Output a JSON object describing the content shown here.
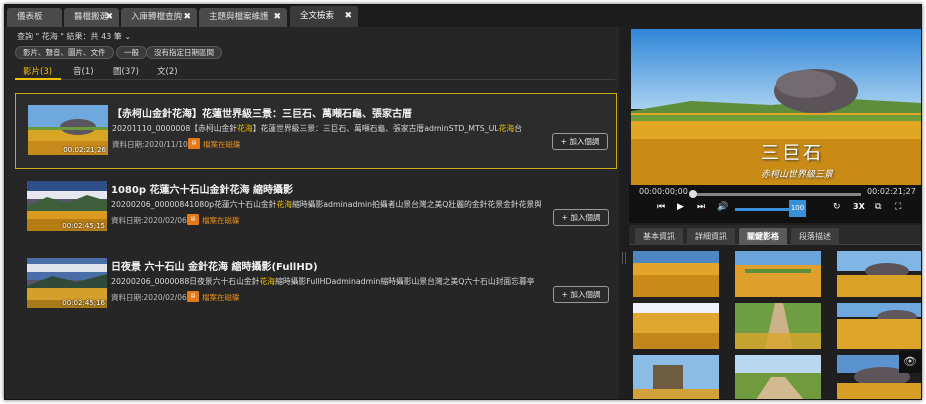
{
  "tabs": [
    {
      "label": "儀表板",
      "closable": false
    },
    {
      "label": "醫檔搬選",
      "closable": true
    },
    {
      "label": "入庫轉檔查詢",
      "closable": true
    },
    {
      "label": "主題與檔案維護",
      "closable": true
    },
    {
      "label": "全文檢索",
      "closable": true,
      "active": true
    }
  ],
  "close_glyph": "✖",
  "search": {
    "query_text": "查詢 \" 花海 \" 結果：共 43 筆",
    "chips": [
      "影片、聲音、圖片、文件",
      "一般",
      "沒有指定日期區間"
    ]
  },
  "categories": [
    {
      "label": "影片(3)",
      "active": true
    },
    {
      "label": "音(1)"
    },
    {
      "label": "圖(37)"
    },
    {
      "label": "文(2)"
    }
  ],
  "results": [
    {
      "title": "【赤柯山金針花海】花蓮世界級三景：三巨石、萬噸石龜、張家古厝",
      "desc_before": "20201110_0000008【赤柯山金針",
      "desc_hl": "花海",
      "desc_after": "】花蓮世界級三景：三巨石、萬噸石龜、張家古厝adminSTD_MTS_UL",
      "desc_hl2": "花海",
      "desc_after2": "台",
      "date": "資料日期:2020/11/10",
      "duration": "00:02:21;26",
      "store_label": "檔案在磁碟",
      "add_label": "加入個調",
      "selected": true
    },
    {
      "title": "1080p 花蓮六十石山金針花海 縮時攝影",
      "desc_before": "20200206_00000841080p花蓮六十石山金針",
      "desc_hl": "花海",
      "desc_after": "縮時攝影adminadmin拍攝者山景台灣之美Q壯麗的金針花景金針花景與遠處綠色",
      "desc_hl2": "",
      "desc_after2": "",
      "date": "資料日期:2020/02/06",
      "duration": "00:02:45;15",
      "store_label": "檔案在磁碟",
      "add_label": "加入個調",
      "selected": false
    },
    {
      "title": "日夜景 六十石山 金針花海 縮時攝影(FullHD)",
      "desc_before": "20200206_0000088日夜景六十石山金針",
      "desc_hl": "花海",
      "desc_after": "縮時攝影FullHDadminadmin縮時攝影山景台灣之美Q六十石山封面忘暮亭",
      "desc_hl2": "",
      "desc_after2": "",
      "date": "資料日期:2020/02/06",
      "duration": "00:02:45;16",
      "store_label": "檔案在磁碟",
      "add_label": "加入個調",
      "selected": false
    }
  ],
  "player": {
    "caption_main": "三巨石",
    "caption_sub": "赤柯山世界級三景",
    "current_time": "00:00:00;00",
    "total_time": "00:02:21;27",
    "volume": "100",
    "speed": "3X",
    "progress": 0
  },
  "panel_tabs": [
    {
      "label": "基本資訊"
    },
    {
      "label": "詳細資訊"
    },
    {
      "label": "關鍵影格",
      "active": true
    },
    {
      "label": "段落描述"
    }
  ],
  "colors": {
    "highlight": "#f0c000",
    "accent": "#3a8fd9",
    "selected_border": "#c9ad13"
  }
}
